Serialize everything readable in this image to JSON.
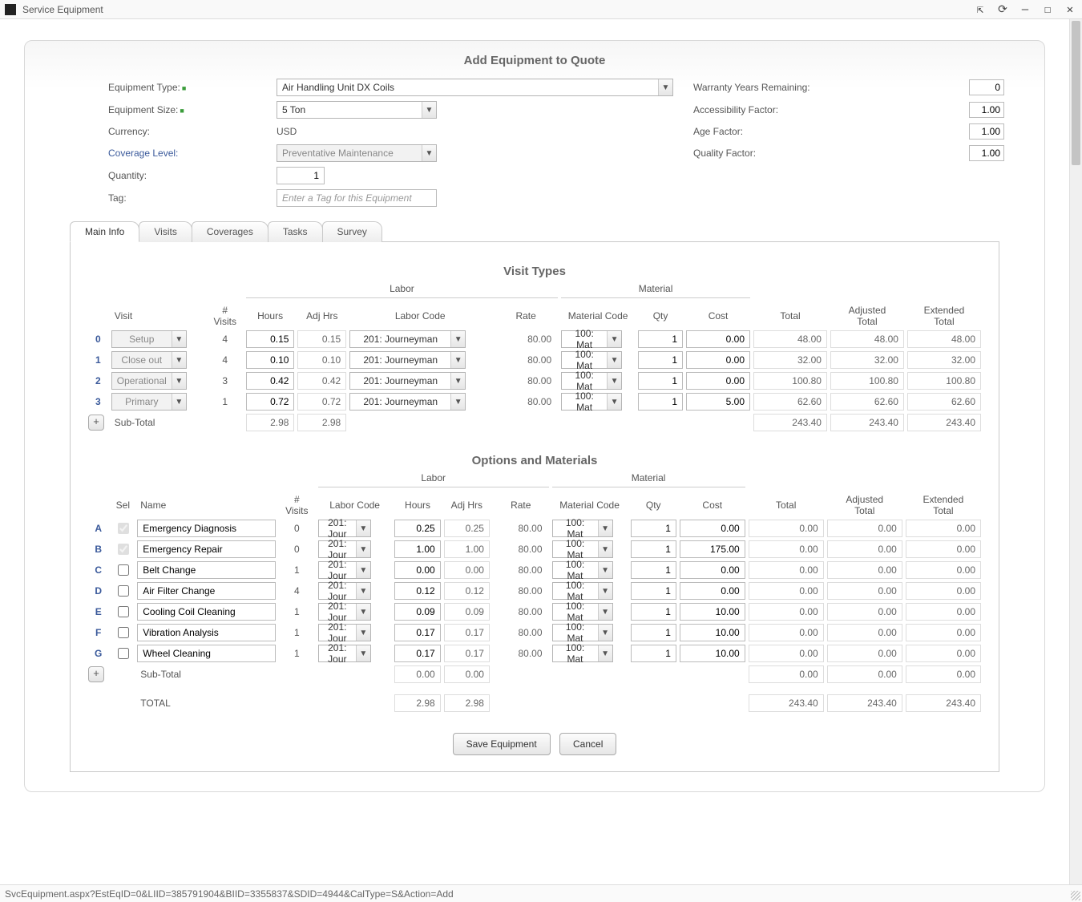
{
  "window": {
    "title": "Service Equipment"
  },
  "panel": {
    "title": "Add Equipment to Quote"
  },
  "form": {
    "equipment_type_label": "Equipment Type:",
    "equipment_type": "Air Handling Unit DX Coils",
    "equipment_size_label": "Equipment Size:",
    "equipment_size": "5 Ton",
    "currency_label": "Currency:",
    "currency": "USD",
    "coverage_label": "Coverage Level:",
    "coverage": "Preventative Maintenance",
    "quantity_label": "Quantity:",
    "quantity": "1",
    "tag_label": "Tag:",
    "tag_placeholder": "Enter a Tag for this Equipment",
    "warranty_label": "Warranty Years Remaining:",
    "warranty": "0",
    "accessibility_label": "Accessibility Factor:",
    "accessibility": "1.00",
    "age_label": "Age Factor:",
    "age": "1.00",
    "quality_label": "Quality Factor:",
    "quality": "1.00"
  },
  "tabs": [
    "Main Info",
    "Visits",
    "Coverages",
    "Tasks",
    "Survey"
  ],
  "visit_types": {
    "title": "Visit Types",
    "group_labor": "Labor",
    "group_material": "Material",
    "headers": {
      "visit": "Visit",
      "nvisits": "#\nVisits",
      "hours": "Hours",
      "adjhrs": "Adj Hrs",
      "laborcode": "Labor Code",
      "rate": "Rate",
      "matcode": "Material Code",
      "qty": "Qty",
      "cost": "Cost",
      "total": "Total",
      "adjtotal": "Adjusted\nTotal",
      "exttotal": "Extended\nTotal"
    },
    "rows": [
      {
        "n": "0",
        "name": "Setup",
        "visits": "4",
        "hours": "0.15",
        "adj": "0.15",
        "lcode": "201: Journeyman",
        "rate": "80.00",
        "mcode": "100: Mat",
        "qty": "1",
        "cost": "0.00",
        "total": "48.00",
        "adjt": "48.00",
        "ext": "48.00"
      },
      {
        "n": "1",
        "name": "Close out",
        "visits": "4",
        "hours": "0.10",
        "adj": "0.10",
        "lcode": "201: Journeyman",
        "rate": "80.00",
        "mcode": "100: Mat",
        "qty": "1",
        "cost": "0.00",
        "total": "32.00",
        "adjt": "32.00",
        "ext": "32.00"
      },
      {
        "n": "2",
        "name": "Operational",
        "visits": "3",
        "hours": "0.42",
        "adj": "0.42",
        "lcode": "201: Journeyman",
        "rate": "80.00",
        "mcode": "100: Mat",
        "qty": "1",
        "cost": "0.00",
        "total": "100.80",
        "adjt": "100.80",
        "ext": "100.80"
      },
      {
        "n": "3",
        "name": "Primary",
        "visits": "1",
        "hours": "0.72",
        "adj": "0.72",
        "lcode": "201: Journeyman",
        "rate": "80.00",
        "mcode": "100: Mat",
        "qty": "1",
        "cost": "5.00",
        "total": "62.60",
        "adjt": "62.60",
        "ext": "62.60"
      }
    ],
    "subtotal": {
      "label": "Sub-Total",
      "hours": "2.98",
      "adj": "2.98",
      "total": "243.40",
      "adjt": "243.40",
      "ext": "243.40"
    }
  },
  "options": {
    "title": "Options and Materials",
    "headers": {
      "sel": "Sel",
      "name": "Name",
      "nvisits": "#\nVisits",
      "laborcode": "Labor Code",
      "hours": "Hours",
      "adjhrs": "Adj Hrs",
      "rate": "Rate",
      "matcode": "Material Code",
      "qty": "Qty",
      "cost": "Cost",
      "total": "Total",
      "adjtotal": "Adjusted\nTotal",
      "exttotal": "Extended\nTotal"
    },
    "rows": [
      {
        "n": "A",
        "sel": true,
        "dis": true,
        "name": "Emergency Diagnosis",
        "visits": "0",
        "lcode": "201: Jour",
        "hours": "0.25",
        "adj": "0.25",
        "rate": "80.00",
        "mcode": "100: Mat",
        "qty": "1",
        "cost": "0.00",
        "total": "0.00",
        "adjt": "0.00",
        "ext": "0.00"
      },
      {
        "n": "B",
        "sel": true,
        "dis": true,
        "name": "Emergency Repair",
        "visits": "0",
        "lcode": "201: Jour",
        "hours": "1.00",
        "adj": "1.00",
        "rate": "80.00",
        "mcode": "100: Mat",
        "qty": "1",
        "cost": "175.00",
        "total": "0.00",
        "adjt": "0.00",
        "ext": "0.00"
      },
      {
        "n": "C",
        "sel": false,
        "dis": false,
        "name": "Belt Change",
        "visits": "1",
        "lcode": "201: Jour",
        "hours": "0.00",
        "adj": "0.00",
        "rate": "80.00",
        "mcode": "100: Mat",
        "qty": "1",
        "cost": "0.00",
        "total": "0.00",
        "adjt": "0.00",
        "ext": "0.00"
      },
      {
        "n": "D",
        "sel": false,
        "dis": false,
        "name": "Air Filter Change",
        "visits": "4",
        "lcode": "201: Jour",
        "hours": "0.12",
        "adj": "0.12",
        "rate": "80.00",
        "mcode": "100: Mat",
        "qty": "1",
        "cost": "0.00",
        "total": "0.00",
        "adjt": "0.00",
        "ext": "0.00"
      },
      {
        "n": "E",
        "sel": false,
        "dis": false,
        "name": "Cooling Coil Cleaning",
        "visits": "1",
        "lcode": "201: Jour",
        "hours": "0.09",
        "adj": "0.09",
        "rate": "80.00",
        "mcode": "100: Mat",
        "qty": "1",
        "cost": "10.00",
        "total": "0.00",
        "adjt": "0.00",
        "ext": "0.00"
      },
      {
        "n": "F",
        "sel": false,
        "dis": false,
        "name": "Vibration Analysis",
        "visits": "1",
        "lcode": "201: Jour",
        "hours": "0.17",
        "adj": "0.17",
        "rate": "80.00",
        "mcode": "100: Mat",
        "qty": "1",
        "cost": "10.00",
        "total": "0.00",
        "adjt": "0.00",
        "ext": "0.00"
      },
      {
        "n": "G",
        "sel": false,
        "dis": false,
        "name": "Wheel Cleaning",
        "visits": "1",
        "lcode": "201: Jour",
        "hours": "0.17",
        "adj": "0.17",
        "rate": "80.00",
        "mcode": "100: Mat",
        "qty": "1",
        "cost": "10.00",
        "total": "0.00",
        "adjt": "0.00",
        "ext": "0.00"
      }
    ],
    "subtotal": {
      "label": "Sub-Total",
      "hours": "0.00",
      "adj": "0.00",
      "total": "0.00",
      "adjt": "0.00",
      "ext": "0.00"
    },
    "total": {
      "label": "TOTAL",
      "hours": "2.98",
      "adj": "2.98",
      "total": "243.40",
      "adjt": "243.40",
      "ext": "243.40"
    }
  },
  "actions": {
    "save": "Save Equipment",
    "cancel": "Cancel"
  },
  "statusbar": "SvcEquipment.aspx?EstEqID=0&LIID=385791904&BIID=3355837&SDID=4944&CalType=S&Action=Add"
}
